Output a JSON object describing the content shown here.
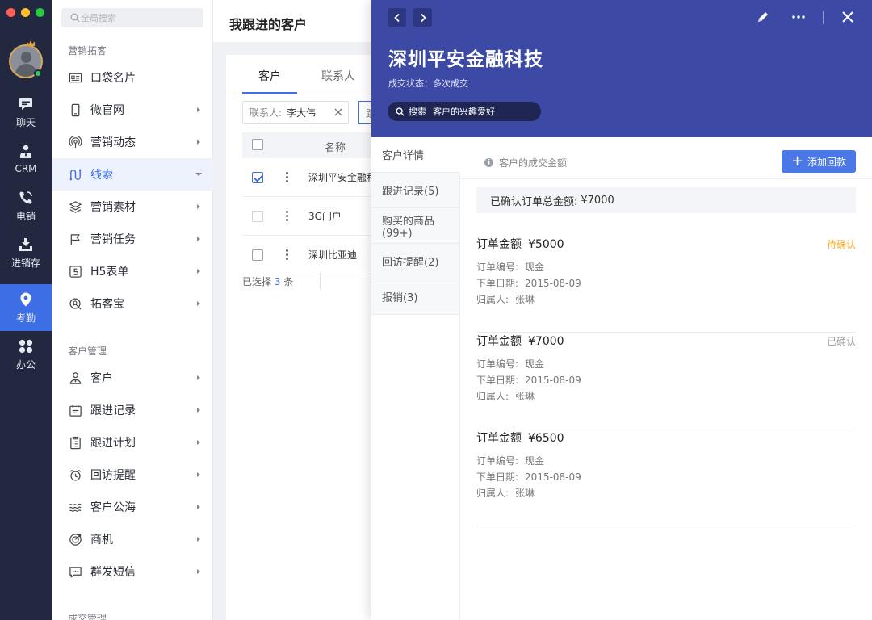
{
  "rail": {
    "items": [
      {
        "label": "聊天",
        "icon": "chat-icon"
      },
      {
        "label": "CRM",
        "icon": "crm-icon"
      },
      {
        "label": "电销",
        "icon": "phone-icon"
      },
      {
        "label": "进销存",
        "icon": "inventory-icon"
      },
      {
        "label": "考勤",
        "icon": "location-pin-icon",
        "active": true
      },
      {
        "label": "办公",
        "icon": "apps-grid-icon"
      }
    ]
  },
  "menu": {
    "search_placeholder": "全局搜索",
    "section1": "营销拓客",
    "section1_items": [
      {
        "label": "口袋名片",
        "icon": "card-icon"
      },
      {
        "label": "微官网",
        "icon": "mobile-icon"
      },
      {
        "label": "营销动态",
        "icon": "broadcast-icon"
      },
      {
        "label": "线索",
        "icon": "clue-icon",
        "active": true
      },
      {
        "label": "营销素材",
        "icon": "layers-icon"
      },
      {
        "label": "营销任务",
        "icon": "flag-icon"
      },
      {
        "label": "H5表单",
        "icon": "h5-icon"
      },
      {
        "label": "拓客宝",
        "icon": "search-user-icon"
      }
    ],
    "section2": "客户管理",
    "section2_items": [
      {
        "label": "客户",
        "icon": "person-icon"
      },
      {
        "label": "跟进记录",
        "icon": "calendar-icon"
      },
      {
        "label": "跟进计划",
        "icon": "clipboard-icon"
      },
      {
        "label": "回访提醒",
        "icon": "alarm-icon"
      },
      {
        "label": "客户公海",
        "icon": "waves-icon"
      },
      {
        "label": "商机",
        "icon": "target-icon"
      },
      {
        "label": "群发短信",
        "icon": "sms-icon"
      }
    ],
    "section3": "成交管理"
  },
  "list": {
    "page_title": "我跟进的客户",
    "tabs": [
      "客户",
      "联系人"
    ],
    "filter_label": "联系人:",
    "filter_value": "李大伟",
    "filter2_label": "跟",
    "col_name": "名称",
    "rows": [
      {
        "name": "深圳平安金融科技",
        "checked": true
      },
      {
        "name": "3G门户",
        "checked": false
      },
      {
        "name": "深圳比亚迪",
        "checked": false
      }
    ],
    "selected_prefix": "已选择",
    "selected_count": "3",
    "selected_suffix": "条"
  },
  "detail": {
    "title": "深圳平安金融科技",
    "status_label": "成交状态：",
    "status_value": "多次成交",
    "search_label": "搜索",
    "search_hint": "客户的兴趣爱好",
    "tabs": [
      "客户详情",
      "跟进记录(5)",
      "购买的商品(99+)",
      "回访提醒(2)",
      "报销(3)"
    ],
    "info_text": "客户的成交金额",
    "add_button": "添加回款",
    "total_label": "已确认订单总金额:",
    "total_value": "¥7000",
    "orders": [
      {
        "amount_label": "订单金额",
        "amount": "¥5000",
        "status": "待确认",
        "status_color": "#f5a623",
        "no_label": "订单编号:",
        "no_value": "现金",
        "date_label": "下单日期:",
        "date_value": "2015-08-09",
        "owner_label": "归属人:",
        "owner_value": "张琳"
      },
      {
        "amount_label": "订单金额",
        "amount": "¥7000",
        "status": "已确认",
        "status_color": "#999999",
        "no_label": "订单编号:",
        "no_value": "现金",
        "date_label": "下单日期:",
        "date_value": "2015-08-09",
        "owner_label": "归属人:",
        "owner_value": "张琳"
      },
      {
        "amount_label": "订单金额",
        "amount": "¥6500",
        "status": "",
        "status_color": "#999999",
        "no_label": "订单编号:",
        "no_value": "现金",
        "date_label": "下单日期:",
        "date_value": "2015-08-09",
        "owner_label": "归属人:",
        "owner_value": "张琳"
      }
    ]
  },
  "colors": {
    "accent": "#3e6ee5",
    "header": "#3c4aa5",
    "rail": "#232841",
    "pending": "#f5a623"
  }
}
